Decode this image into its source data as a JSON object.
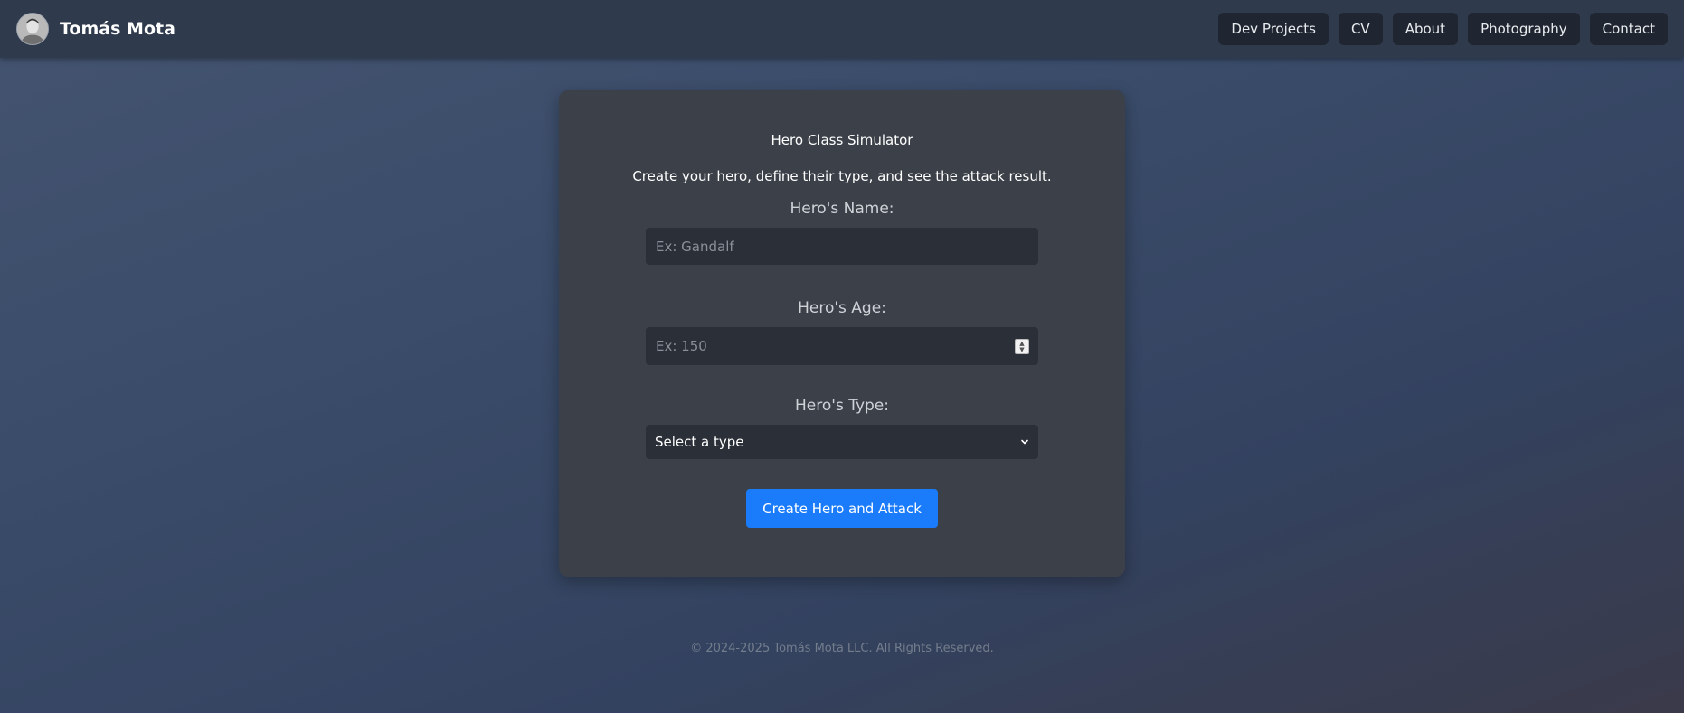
{
  "header": {
    "brand_name": "Tomás Mota",
    "avatar_icon": "profile-photo",
    "nav": [
      {
        "label": "Dev Projects"
      },
      {
        "label": "CV"
      },
      {
        "label": "About"
      },
      {
        "label": "Photography"
      },
      {
        "label": "Contact"
      }
    ]
  },
  "card": {
    "title": "Hero Class Simulator",
    "subtitle": "Create your hero, define their type, and see the attack result.",
    "name_label": "Hero's Name:",
    "name_placeholder": "Ex: Gandalf",
    "name_value": "",
    "age_label": "Hero's Age:",
    "age_placeholder": "Ex: 150",
    "age_value": "",
    "type_label": "Hero's Type:",
    "type_selected": "Select a type",
    "submit_label": "Create Hero and Attack"
  },
  "footer": {
    "copyright": "© 2024-2025 Tomás Mota LLC. All Rights Reserved."
  },
  "colors": {
    "accent": "#1a7cfa",
    "card_bg": "#3c4049",
    "input_bg": "#2b2f38",
    "nav_btn_bg": "#1f2631"
  }
}
